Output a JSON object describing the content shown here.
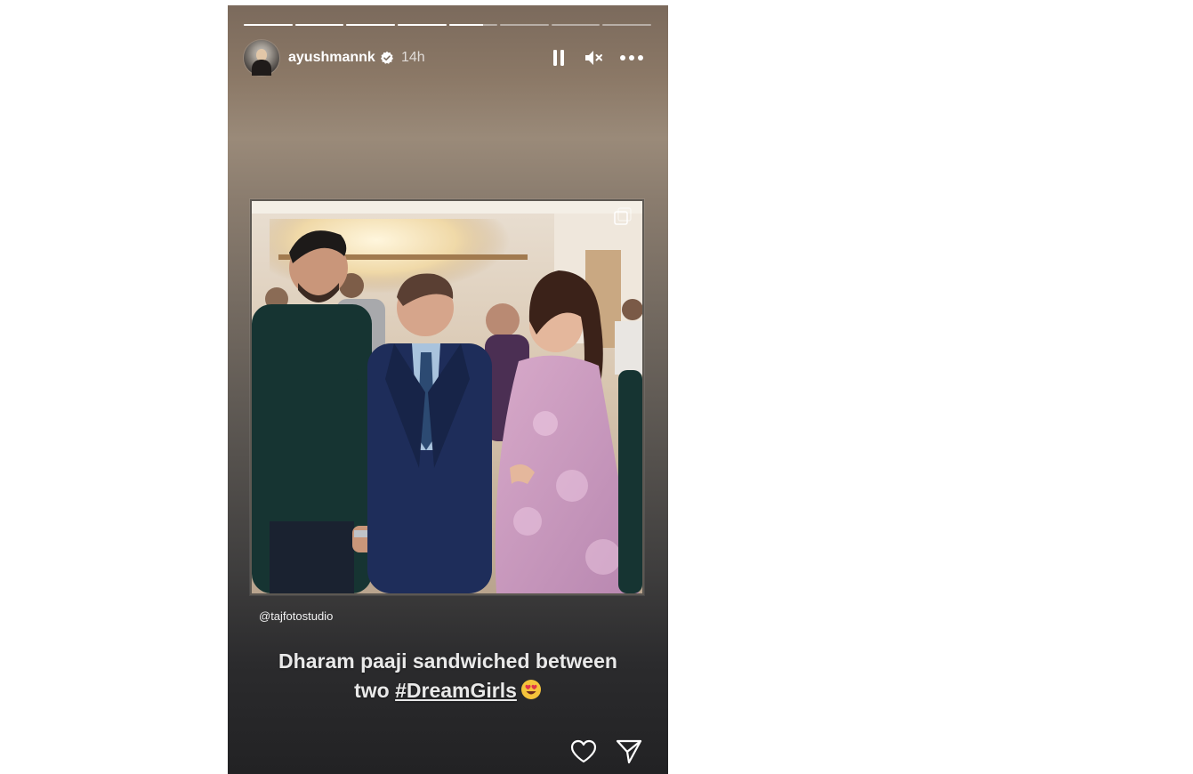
{
  "story": {
    "progress": {
      "segments": [
        1,
        1,
        1,
        1,
        0.7,
        0,
        0,
        0
      ]
    },
    "header": {
      "username": "ayushmannk",
      "timestamp": "14h",
      "verified": true
    },
    "controls": {
      "pause": "pause-icon",
      "mute": "muted-speaker-icon",
      "more": "more-options-icon"
    },
    "media": {
      "credit": "@tajfotostudio"
    },
    "caption": {
      "line1": "Dharam paaji sandwiched between",
      "line2_prefix": "two ",
      "hashtag": "#DreamGirls",
      "emoji": "heart-eyes-emoji"
    },
    "actions": {
      "like": "heart-icon",
      "share": "send-icon"
    },
    "colors": {
      "text": "#ffffff",
      "verified_badge": "#ffffff"
    }
  }
}
